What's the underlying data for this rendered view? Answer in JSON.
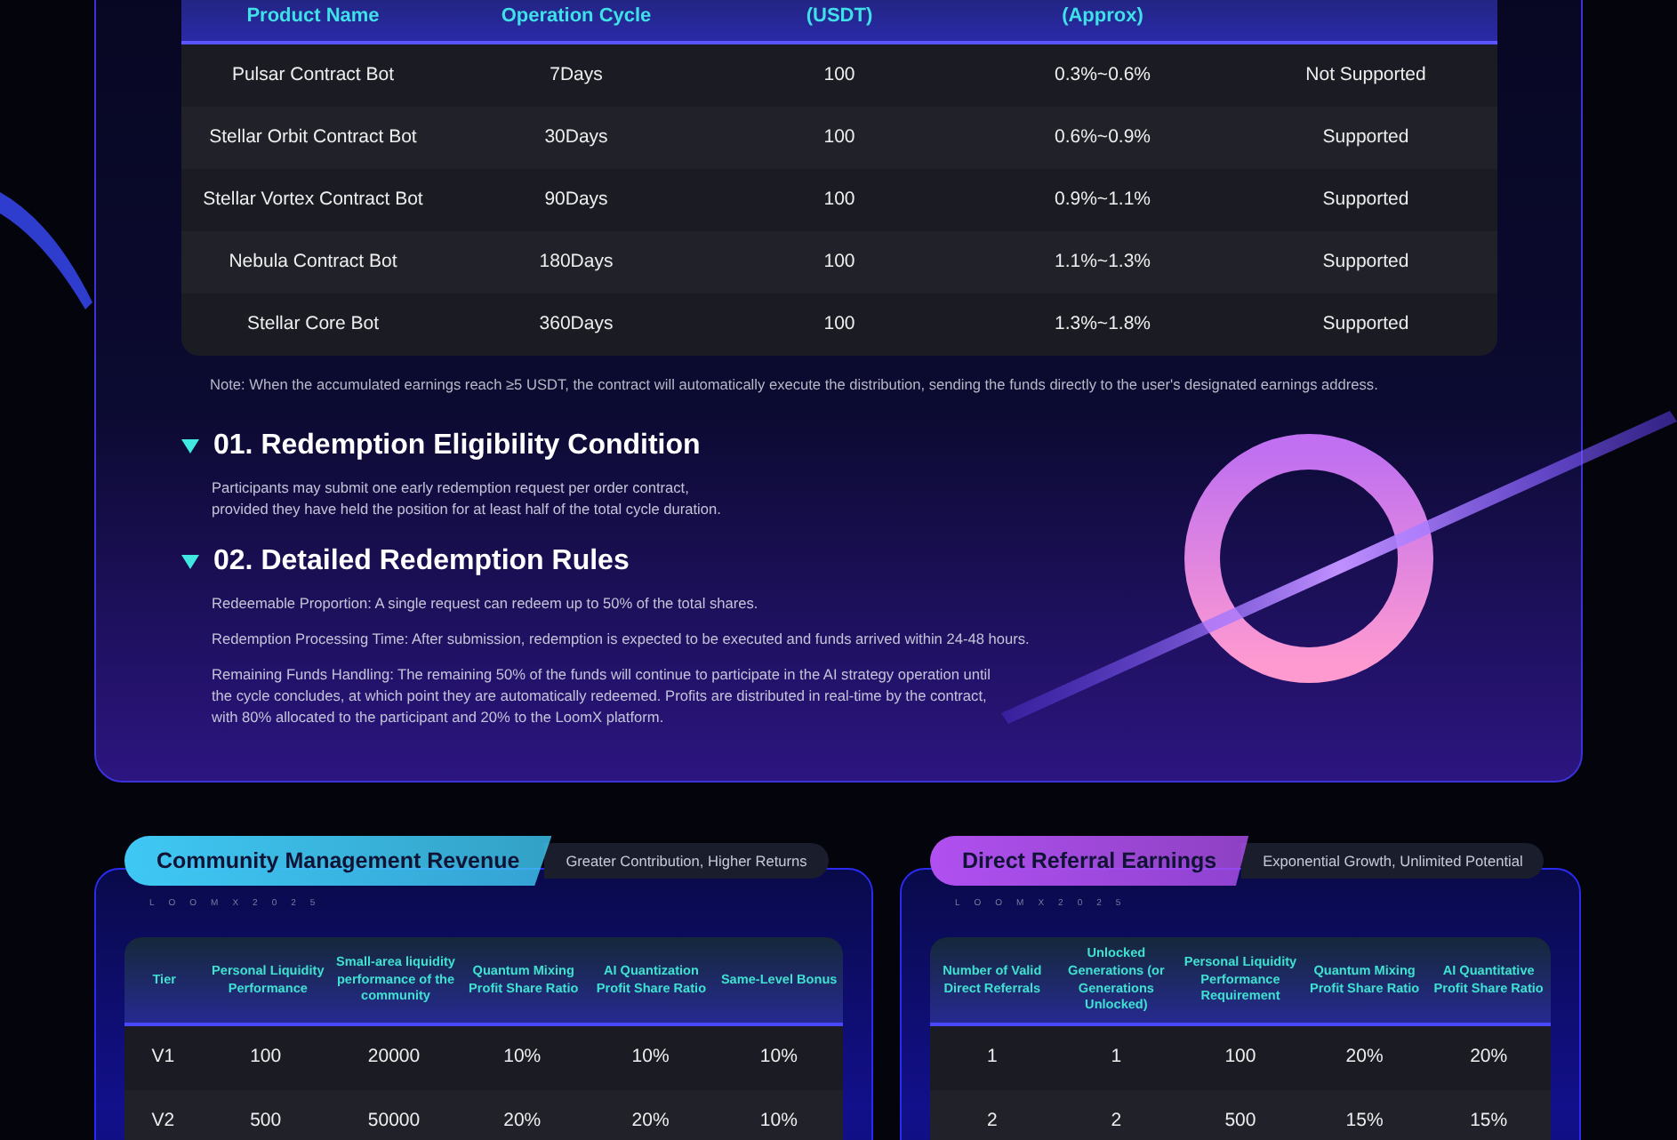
{
  "products_table": {
    "columns": [
      "Product Name",
      "Operation Cycle",
      "(USDT)",
      "(Approx)"
    ],
    "rows": [
      [
        "Pulsar Contract Bot",
        "7Days",
        "100",
        "0.3%~0.6%",
        "Not Supported"
      ],
      [
        "Stellar Orbit Contract Bot",
        "30Days",
        "100",
        "0.6%~0.9%",
        "Supported"
      ],
      [
        "Stellar Vortex Contract Bot",
        "90Days",
        "100",
        "0.9%~1.1%",
        "Supported"
      ],
      [
        "Nebula Contract Bot",
        "180Days",
        "100",
        "1.1%~1.3%",
        "Supported"
      ],
      [
        "Stellar Core Bot",
        "360Days",
        "100",
        "1.3%~1.8%",
        "Supported"
      ]
    ]
  },
  "note": "Note: When the accumulated earnings reach ≥5 USDT, the contract will automatically execute the distribution, sending the funds directly to the user's designated earnings address.",
  "sections": [
    {
      "title": "01. Redemption Eligibility Condition",
      "paragraphs": [
        "Participants may submit one early redemption request per order contract,\nprovided they have held the position for at least half of the total cycle duration."
      ]
    },
    {
      "title": "02. Detailed Redemption Rules",
      "paragraphs": [
        "Redeemable Proportion: A single request can redeem up to 50% of the total shares.",
        "Redemption Processing Time: After submission, redemption is expected to be executed and funds arrived within 24-48 hours.",
        "Remaining Funds Handling: The remaining 50% of the funds will continue to participate in the AI strategy operation until\nthe cycle concludes, at which point they are automatically redeemed. Profits are distributed in real-time by the contract,\nwith 80% allocated to the participant and 20% to the LoomX platform."
      ]
    }
  ],
  "panels": [
    {
      "title": "Community Management Revenue",
      "subtitle": "Greater Contribution, Higher Returns",
      "color": "#3fc8f4",
      "watermark": "LOOMX2025",
      "columns": [
        "Tier",
        "Personal Liquidity Performance",
        "Small-area liquidity performance of the community",
        "Quantum Mixing Profit Share Ratio",
        "AI Quantization Profit Share Ratio",
        "Same-Level Bonus"
      ],
      "rows": [
        [
          "V1",
          "100",
          "20000",
          "10%",
          "10%",
          "10%"
        ],
        [
          "V2",
          "500",
          "50000",
          "20%",
          "20%",
          "10%"
        ]
      ]
    },
    {
      "title": "Direct Referral Earnings",
      "subtitle": "Exponential Growth, Unlimited Potential",
      "color": "#b050f0",
      "watermark": "LOOMX2025",
      "columns": [
        "Number of Valid Direct Referrals",
        "Unlocked Generations (or Generations Unlocked)",
        "Personal Liquidity Performance Requirement",
        "Quantum Mixing Profit Share Ratio",
        "AI Quantitative Profit Share Ratio"
      ],
      "rows": [
        [
          "1",
          "1",
          "100",
          "20%",
          "20%"
        ],
        [
          "2",
          "2",
          "500",
          "15%",
          "15%"
        ]
      ]
    }
  ]
}
